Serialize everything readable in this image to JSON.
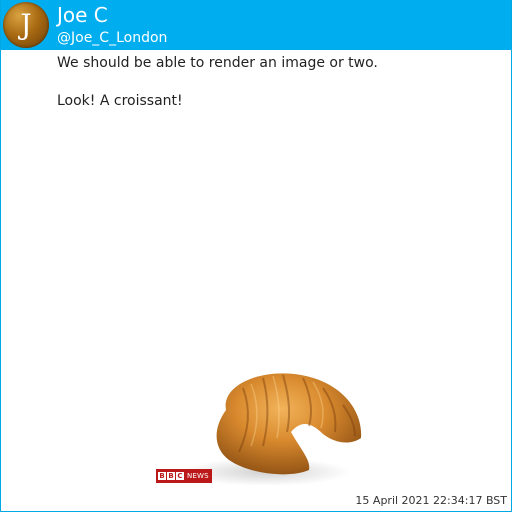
{
  "user": {
    "avatar_letter": "J",
    "display_name": "Joe C",
    "handle": "@Joe_C_London"
  },
  "post": {
    "lines": [
      "We should be able to render an image or two.",
      "Look! A croissant!"
    ],
    "media": {
      "subject": "croissant",
      "logo_box_letters": [
        "B",
        "B",
        "C"
      ],
      "logo_text": "NEWS"
    },
    "timestamp": "15 April 2021 22:34:17 BST"
  },
  "colors": {
    "header_bg": "#00aeef",
    "text": "#222222",
    "bbc_red": "#bb1919"
  }
}
